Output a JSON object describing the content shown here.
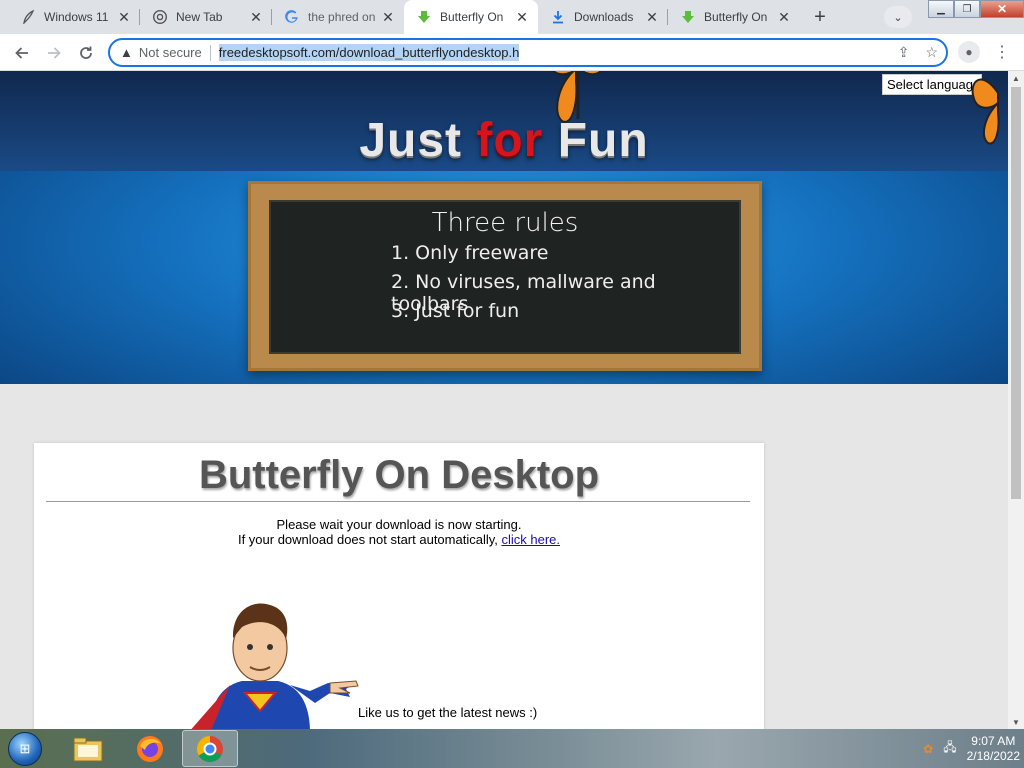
{
  "tabs": [
    {
      "title": "Windows 11",
      "icon": "feather-icon"
    },
    {
      "title": "New Tab",
      "icon": "chrome-icon"
    },
    {
      "title": "the phred on",
      "icon": "google-icon"
    },
    {
      "title": "Butterfly On",
      "icon": "download-arrow-icon",
      "active": true
    },
    {
      "title": "Downloads",
      "icon": "download-icon"
    },
    {
      "title": "Butterfly On",
      "icon": "download-arrow-icon"
    }
  ],
  "toolbar": {
    "security_label": "Not secure",
    "url": "freedesktopsoft.com/download_butterflyondesktop.h"
  },
  "page": {
    "language_select": "Select language",
    "logo": {
      "part1": "Just ",
      "part2": "for",
      "part3": " Fun"
    },
    "board": {
      "title": "Three rules",
      "rules": [
        "1. Only freeware",
        "2. No viruses, mallware and toolbars",
        "3. Just for fun"
      ]
    },
    "card": {
      "title": "Butterfly On Desktop",
      "line1": "Please wait your download is now starting.",
      "line2": "If your download does not start automatically,",
      "link": "click here.",
      "like": "Like us to get the latest news :)"
    }
  },
  "taskbar": {
    "time": "9:07 AM",
    "date": "2/18/2022"
  },
  "colors": {
    "accent": "#1a73e8",
    "logo_red": "#d7131c",
    "link": "#1a0dab"
  }
}
